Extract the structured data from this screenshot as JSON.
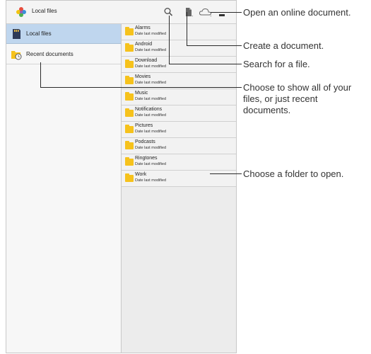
{
  "app": {
    "title": "Local files"
  },
  "nav": [
    {
      "label": "Local files"
    },
    {
      "label": "Recent documents"
    }
  ],
  "folders": [
    {
      "name": "Alarms",
      "modified": "Date last modified"
    },
    {
      "name": "Android",
      "modified": "Date last modified"
    },
    {
      "name": "Download",
      "modified": "Date last modified"
    },
    {
      "name": "Movies",
      "modified": "Date last modified"
    },
    {
      "name": "Music",
      "modified": "Date last modified"
    },
    {
      "name": "Notifications",
      "modified": "Date last modified"
    },
    {
      "name": "Pictures",
      "modified": "Date last modified"
    },
    {
      "name": "Podcasts",
      "modified": "Date last modified"
    },
    {
      "name": "Ringtones",
      "modified": "Date last modified"
    },
    {
      "name": "Work",
      "modified": "Date last modified"
    }
  ],
  "callouts": {
    "online": "Open an online document.",
    "create": "Create a document.",
    "search": "Search for a file.",
    "choose": "Choose to show all of your files, or just recent documents.",
    "folder": "Choose a folder to open."
  },
  "icons": {
    "app": "pinwheel-app-icon",
    "search": "search-icon",
    "create": "new-document-icon",
    "cloud": "cloud-icon",
    "menu": "overflow-menu-icon",
    "sd": "sd-card-icon",
    "recent": "recent-folder-icon",
    "folder": "folder-icon"
  },
  "colors": {
    "folder": "#f6c21c",
    "selected": "#bfd6ee"
  }
}
